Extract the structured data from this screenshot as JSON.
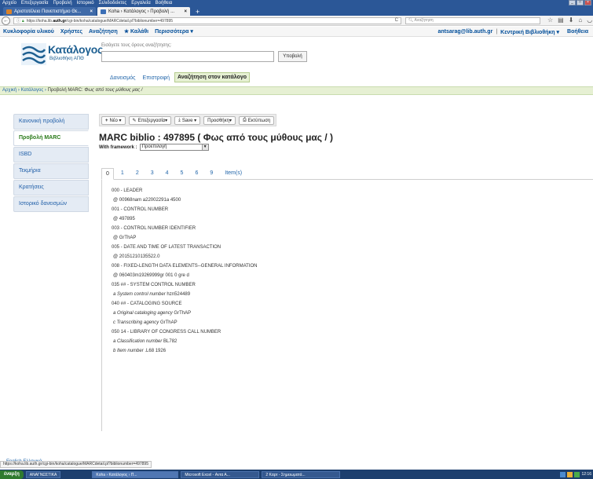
{
  "browser": {
    "menu": [
      "Αρχείο",
      "Επεξεργασία",
      "Προβολή",
      "Ιστορικό",
      "Σελιδοδείκτες",
      "Εργαλεία",
      "Βοήθεια"
    ],
    "tabs": [
      {
        "label": "Αριστοτέλειο Πανεπιστήμιο Θε..."
      },
      {
        "label": "Koha › Κατάλογος › Προβολή ..."
      }
    ],
    "new_tab": "+",
    "url_prefix": "https://koha.lib.",
    "url_host": "auth.gr",
    "url_rest": "/cgi-bin/koha/catalogue/MARCdetail.pl?biblionumber=497895",
    "search_placeholder": "Αναζήτηση"
  },
  "koha_nav": {
    "left": [
      "Κυκλοφορία υλικού",
      "Χρήστες",
      "Αναζήτηση",
      "★ Καλάθι",
      "Περισσότερα ▾"
    ],
    "user": "antsarag@lib.auth.gr",
    "branch": "Κεντρική Βιβλιοθήκη ▾",
    "help": "Βοήθεια"
  },
  "header": {
    "logo_title": "Κατάλογος",
    "logo_subtitle": "Βιβλιοθήκη ΑΠΘ",
    "search_label": "Εισάγετε τους όρους αναζήτησης:",
    "submit": "Υποβολή",
    "search_tabs": [
      "Δανεισμός",
      "Επιστροφή",
      "Αναζήτηση στον κατάλογο"
    ]
  },
  "breadcrumbs": {
    "home": "Αρχική",
    "catalog": "Κατάλογος",
    "current_prefix": "Προβολή MARC:",
    "current_title": "Φως από τους μύθους μας /"
  },
  "sidebar": {
    "items": [
      "Κανονική προβολή",
      "Προβολή MARC",
      "ISBD",
      "Τεκμήρια",
      "Κρατήσεις",
      "Ιστορικό δανεισμών"
    ]
  },
  "toolbar": {
    "new": "Νέο ▾",
    "edit": "Επεξεργασία▾",
    "save": "Save ▾",
    "add": "Προσθήκη▾",
    "print": "Εκτύπωση"
  },
  "record": {
    "title": "MARC biblio : 497895 ( Φως από τους μύθους μας / )",
    "framework_label": "With framework :",
    "framework_value": "Προεπιλογή"
  },
  "marc_tabs": [
    "0",
    "1",
    "2",
    "3",
    "4",
    "5",
    "6",
    "9",
    "Item(s)"
  ],
  "marc_fields": [
    {
      "tag": "000 - LEADER",
      "subs": [
        {
          "code": "@",
          "label": "",
          "value": "00968nam a22002291a 4500"
        }
      ]
    },
    {
      "tag": "001 - CONTROL NUMBER",
      "subs": [
        {
          "code": "@",
          "label": "",
          "value": "497895"
        }
      ]
    },
    {
      "tag": "003 - CONTROL NUMBER IDENTIFIER",
      "subs": [
        {
          "code": "@",
          "label": "",
          "value": "GrThAP"
        }
      ]
    },
    {
      "tag": "005 - DATE AND TIME OF LATEST TRANSACTION",
      "subs": [
        {
          "code": "@",
          "label": "",
          "value": "20151210135522.0"
        }
      ]
    },
    {
      "tag": "008 - FIXED-LENGTH DATA ELEMENTS--GENERAL INFORMATION",
      "subs": [
        {
          "code": "@",
          "label": "",
          "value": "060403m19269999gr 001 0 gre d"
        }
      ]
    },
    {
      "tag": "035 ## - SYSTEM CONTROL NUMBER",
      "subs": [
        {
          "code": "a",
          "label": "System control number",
          "value": "hzn524489"
        }
      ]
    },
    {
      "tag": "040 ## - CATALOGING SOURCE",
      "subs": [
        {
          "code": "a",
          "label": "Original cataloging agency",
          "value": "GrThAP"
        },
        {
          "code": "c",
          "label": "Transcribing agency",
          "value": "GrThAP"
        }
      ]
    },
    {
      "tag": "050 14 - LIBRARY OF CONGRESS CALL NUMBER",
      "subs": [
        {
          "code": "a",
          "label": "Classification number",
          "value": "BL782"
        },
        {
          "code": "b",
          "label": "Item number",
          "value": ".L68 1926"
        }
      ]
    }
  ],
  "footer": {
    "lang": "English   Ελληνικά",
    "status_url": "https://koha.lib.auth.gr/cgi-bin/koha/catalogue/MARCdetail.pl?biblionumber=497895"
  },
  "taskbar": {
    "start": "έναρξη",
    "tasks": [
      "ΑΝΑΓΝΩΣΤΙΚΑ",
      "Koha › Κατάλογος › Π...",
      "Microsoft Excel - Αντα Α...",
      "2 Καρτ - Σημειωματά..."
    ],
    "clock": "12:16"
  },
  "icons": {
    "back": "back-arrow-icon",
    "info": "info-icon",
    "lock": "lock-icon",
    "reload": "reload-icon",
    "search": "search-icon",
    "star": "star-icon",
    "bookmarks": "bookmarks-icon",
    "download": "download-icon",
    "home": "home-icon",
    "pocket": "pocket-icon",
    "menu": "hamburger-menu-icon"
  },
  "colors": {
    "window": "#2b5797",
    "breadcrumb_bg": "#e6f0d3",
    "link": "#2266aa",
    "active_side": "#2a7a1a"
  }
}
